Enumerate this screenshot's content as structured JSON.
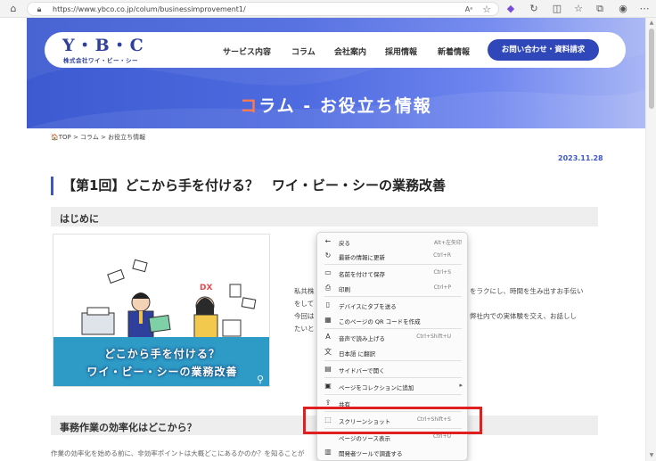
{
  "browser": {
    "url": "https://www.ybco.co.jp/colum/businessimprovement1/",
    "read_aloud_label": "Aᵃ"
  },
  "header": {
    "logo_text": "Y・B・C",
    "logo_subtext": "株式会社ワイ・ビー・シー",
    "nav": [
      "サービス内容",
      "コラム",
      "会社案内",
      "採用情報",
      "新着情報"
    ],
    "cta_label": "お問い合わせ・資料請求",
    "page_title_accent": "コ",
    "page_title_rest": "ラム - お役立ち情報"
  },
  "breadcrumb": "🏠TOP > コラム > お役立ち情報",
  "article": {
    "date": "2023.11.28",
    "title": "【第1回】どこから手を付ける？　ワイ・ビー・シーの業務改善",
    "section1": "はじめに",
    "image_line1": "どこから手を付ける？",
    "image_line2": "ワイ・ビー・シーの業務改善",
    "image_tag": "DX",
    "body_lines": [
      "私共株",
      "をして",
      "今回は",
      "たいと"
    ],
    "body_right_lines": [
      "をラクにし、時間を生み出すお手伝い",
      "",
      "弊社内での実体験を交え、お話しし",
      ""
    ],
    "section2": "事務作業の効率化はどこから？",
    "section2_text": "作業の効率化を始める前に、非効率ポイントは大概どこにあるかのか？を知ることが"
  },
  "context_menu": {
    "items": [
      {
        "icon": "back-arrow-icon",
        "glyph": "←",
        "label": "戻る",
        "shortcut": "Alt+左矢印"
      },
      {
        "icon": "refresh-icon",
        "glyph": "↻",
        "label": "最新の情報に更新",
        "shortcut": "Ctrl+R"
      },
      {
        "icon": "save-icon",
        "glyph": "▭",
        "label": "名前を付けて保存",
        "shortcut": "Ctrl+S"
      },
      {
        "icon": "print-icon",
        "glyph": "⎙",
        "label": "印刷",
        "shortcut": "Ctrl+P"
      },
      {
        "icon": "send-to-device-icon",
        "glyph": "▯",
        "label": "デバイスにタブを送る",
        "shortcut": ""
      },
      {
        "icon": "qr-code-icon",
        "glyph": "▦",
        "label": "このページの QR コードを作成",
        "shortcut": ""
      },
      {
        "icon": "read-aloud-icon",
        "glyph": "A",
        "label": "音声で読み上げる",
        "shortcut": "Ctrl+Shift+U"
      },
      {
        "icon": "translate-icon",
        "glyph": "文",
        "label": "日本語 に翻訳",
        "shortcut": ""
      },
      {
        "icon": "sidebar-icon",
        "glyph": "▤",
        "label": "サイドバーで開く",
        "shortcut": ""
      },
      {
        "icon": "collection-icon",
        "glyph": "▣",
        "label": "ページをコレクションに追加",
        "shortcut": "",
        "submenu": true
      },
      {
        "icon": "share-icon",
        "glyph": "⇪",
        "label": "共有",
        "shortcut": ""
      },
      {
        "icon": "screenshot-icon",
        "glyph": "⬚",
        "label": "スクリーンショット",
        "shortcut": "Ctrl+Shift+S"
      },
      {
        "icon": "view-source-icon",
        "glyph": "",
        "label": "ページのソース表示",
        "shortcut": "Ctrl+U"
      },
      {
        "icon": "devtools-icon",
        "glyph": "▥",
        "label": "開発者ツールで調査する",
        "shortcut": ""
      }
    ]
  },
  "colors": {
    "brand_blue": "#3d57c8",
    "accent_orange": "#ff7a4d",
    "highlight_red": "#e02020"
  }
}
